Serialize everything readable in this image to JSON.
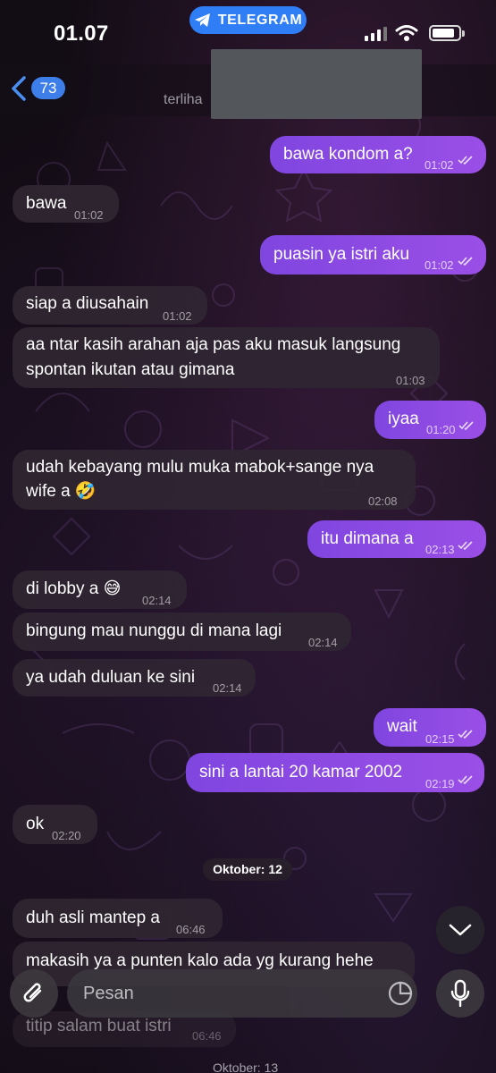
{
  "status_bar": {
    "time": "01.07",
    "app_pill": "TELEGRAM"
  },
  "header": {
    "back_count": "73",
    "subtitle": "terliha"
  },
  "messages": [
    {
      "dir": "out",
      "text": "bawa kondom a?",
      "time": "01:02",
      "read": true
    },
    {
      "dir": "in",
      "text": "bawa",
      "time": "01:02"
    },
    {
      "dir": "out",
      "text": "puasin ya istri aku",
      "time": "01:02",
      "read": true
    },
    {
      "dir": "in",
      "text": "siap a diusahain",
      "time": "01:02"
    },
    {
      "dir": "in",
      "line1": "aa ntar kasih arahan aja pas aku masuk langsung",
      "line2": "spontan ikutan atau gimana",
      "time": "01:03"
    },
    {
      "dir": "out",
      "text": "iyaa",
      "time": "01:20",
      "read": true
    },
    {
      "dir": "in",
      "line1": "udah kebayang mulu muka mabok+sange nya",
      "line2": "wife a 🤣",
      "time": "02:08"
    },
    {
      "dir": "out",
      "text": "itu dimana a",
      "time": "02:13",
      "read": true
    },
    {
      "dir": "in",
      "text": "di lobby a 😅",
      "time": "02:14"
    },
    {
      "dir": "in",
      "text": "bingung mau nunggu di mana lagi",
      "time": "02:14"
    },
    {
      "dir": "in",
      "text": "ya udah duluan ke sini",
      "time": "02:14"
    },
    {
      "dir": "out",
      "text": "wait",
      "time": "02:15",
      "read": true
    },
    {
      "dir": "out",
      "text": "sini a lantai 20 kamar 2002",
      "time": "02:19",
      "read": true
    },
    {
      "dir": "in",
      "text": "ok",
      "time": "02:20"
    },
    {
      "dir": "in",
      "text": "duh asli mantep a",
      "time": "06:46"
    },
    {
      "dir": "in",
      "text": "makasih ya a punten kalo ada yg kurang hehe",
      "time": ""
    },
    {
      "dir": "in",
      "text": "titip salam buat istri",
      "time": "06:46"
    }
  ],
  "date_separator": "Oktober: 12",
  "date_separator_next": "Oktober: 13",
  "composer": {
    "placeholder": "Pesan"
  },
  "icons": {
    "back": "chevron-left-icon",
    "attach": "paperclip-icon",
    "sticker": "sticker-icon",
    "mic": "microphone-icon",
    "scroll": "chevron-down-icon",
    "read": "double-check-icon"
  },
  "colors": {
    "outgoing_bubble": "#8a4ae3",
    "incoming_bubble": "#302632",
    "accent_blue": "#2f7ef5"
  }
}
